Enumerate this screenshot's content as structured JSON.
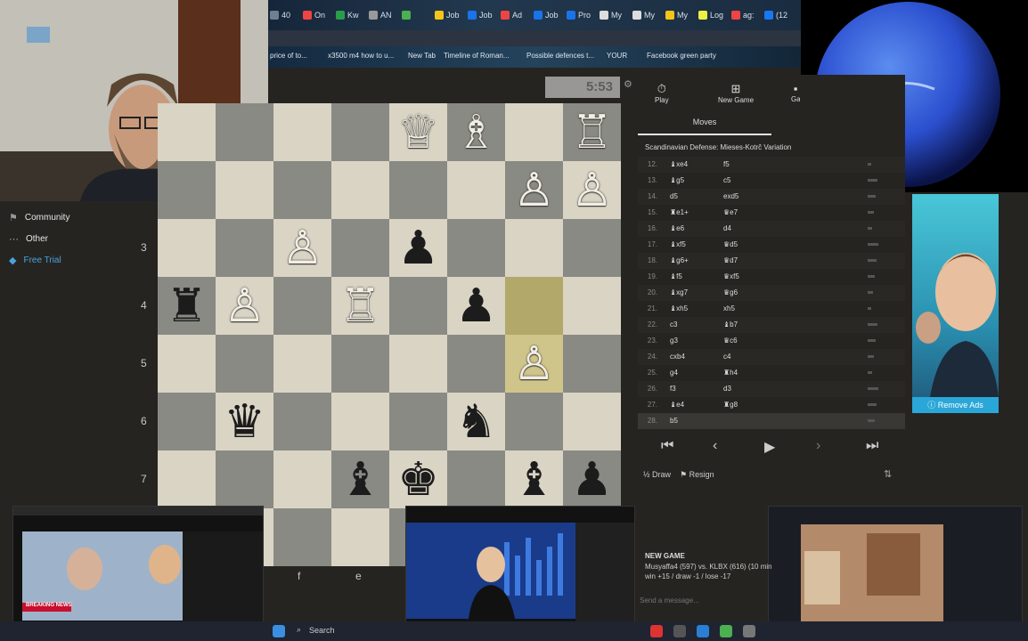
{
  "browser": {
    "tabs": [
      {
        "label": "40",
        "color": "#6f8093"
      },
      {
        "label": "On",
        "color": "#e44"
      },
      {
        "label": "Kw",
        "color": "#2a9d4a"
      },
      {
        "label": "AN",
        "color": "#999"
      },
      {
        "label": "",
        "color": "#4caf50"
      },
      {
        "label": "Job",
        "color": "#f5c518"
      },
      {
        "label": "Job",
        "color": "#1a73e8"
      },
      {
        "label": "Ad",
        "color": "#e44"
      },
      {
        "label": "Job",
        "color": "#1a73e8"
      },
      {
        "label": "Pro",
        "color": "#1a73e8"
      },
      {
        "label": "My",
        "color": "#ddd"
      },
      {
        "label": "My",
        "color": "#ddd"
      },
      {
        "label": "My",
        "color": "#f5c518"
      },
      {
        "label": "Log",
        "color": "#ee4"
      },
      {
        "label": "ag:",
        "color": "#e44"
      },
      {
        "label": "(12",
        "color": "#1877f2"
      }
    ],
    "bookmarks": [
      "price of to...",
      "x3500 m4 how to u...",
      "New Tab",
      "Timeline of Roman...",
      "Possible defences t...",
      "YOUR",
      "Facebook green party"
    ]
  },
  "leftnav": {
    "items": [
      {
        "label": "Community",
        "icon": "community-icon"
      },
      {
        "label": "Other",
        "icon": "more-icon"
      },
      {
        "label": "Free Trial",
        "icon": "diamond-icon",
        "color": "#4aa3df"
      }
    ]
  },
  "clock": "5:53",
  "board": {
    "ranks_shown": [
      "3",
      "4",
      "5",
      "6",
      "7"
    ],
    "files_shown": [
      "f",
      "e"
    ],
    "rows": [
      [
        "",
        "",
        "",
        "",
        "wQ",
        "wB",
        "",
        "wR"
      ],
      [
        "",
        "",
        "",
        "",
        "",
        "",
        "wP",
        "wP"
      ],
      [
        "",
        "",
        "wP",
        "",
        "bP",
        "",
        "",
        ""
      ],
      [
        "bR",
        "wP",
        "",
        "wR",
        "",
        "bP",
        "",
        ""
      ],
      [
        "",
        "",
        "",
        "",
        "",
        "",
        "wP",
        ""
      ],
      [
        "",
        "bQ",
        "",
        "",
        "",
        "bN",
        "",
        ""
      ],
      [
        "",
        "",
        "",
        "bB",
        "bK",
        "",
        "bB",
        "bP"
      ],
      [
        "",
        "",
        "",
        "",
        "",
        "",
        "",
        ""
      ]
    ]
  },
  "play_panel": {
    "buttons": [
      "Play",
      "New Game",
      "Ga"
    ],
    "tab": "Moves",
    "opening": "Scandinavian Defense: Mieses-Kotrč Variation",
    "moves": [
      {
        "n": "12.",
        "w": "♝xe4",
        "b": "f5"
      },
      {
        "n": "13.",
        "w": "♝g5",
        "b": "c5"
      },
      {
        "n": "14.",
        "w": "d5",
        "b": "exd5"
      },
      {
        "n": "15.",
        "w": "♜e1+",
        "b": "♛e7"
      },
      {
        "n": "16.",
        "w": "♝e6",
        "b": "d4"
      },
      {
        "n": "17.",
        "w": "♝xf5",
        "b": "♛d5"
      },
      {
        "n": "18.",
        "w": "♝g6+",
        "b": "♛d7"
      },
      {
        "n": "19.",
        "w": "♝f5",
        "b": "♛xf5"
      },
      {
        "n": "20.",
        "w": "♝xg7",
        "b": "♛g6"
      },
      {
        "n": "21.",
        "w": "♝xh5",
        "b": "xh5"
      },
      {
        "n": "22.",
        "w": "c3",
        "b": "♝b7"
      },
      {
        "n": "23.",
        "w": "g3",
        "b": "♛c6"
      },
      {
        "n": "24.",
        "w": "cxb4",
        "b": "c4"
      },
      {
        "n": "25.",
        "w": "g4",
        "b": "♜h4"
      },
      {
        "n": "26.",
        "w": "f3",
        "b": "d3"
      },
      {
        "n": "27.",
        "w": "♝e4",
        "b": "♜g8"
      },
      {
        "n": "28.",
        "w": "b5",
        "b": ""
      }
    ],
    "draw": "Draw",
    "resign": "Resign"
  },
  "ad": {
    "remove_label": "Remove Ads"
  },
  "chat": {
    "title": "NEW GAME",
    "line1": "Musyaffa4 (597) vs. KLBX (616) (10 min",
    "line2": "win +15 / draw -1 / lose -17",
    "placeholder": "Send a message..."
  },
  "thumbnails": {
    "left_banner": "BREAKING NEWS"
  },
  "taskbar": {
    "search": "Search"
  }
}
